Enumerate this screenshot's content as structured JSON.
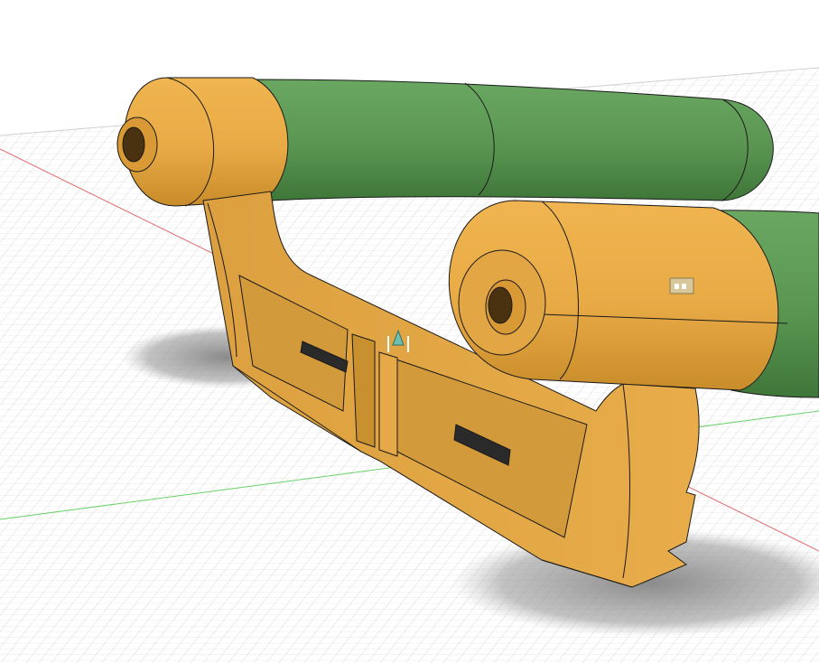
{
  "viewport": {
    "background": "#ffffff",
    "grid_color": "#c9c9c9",
    "x_axis_color": "#e05050",
    "y_axis_color": "#52c052"
  },
  "model": {
    "body_color": "#e8aa45",
    "body_shade_color": "#b8801f",
    "grip_color": "#5a9652",
    "grip_shade_color": "#3f7639",
    "edge_color": "#1a1a1a",
    "shadow_color": "#8f8f8f"
  },
  "markers": {
    "joint_glyph_icon": "component-joint-icon",
    "origin_arrow_icon": "origin-arrow-icon"
  }
}
